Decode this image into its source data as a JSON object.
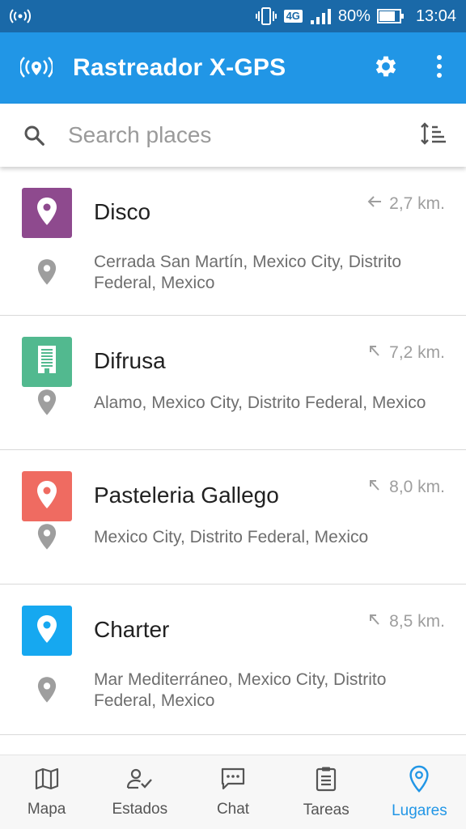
{
  "status_bar": {
    "network": "4G",
    "battery_percent_text": "80%",
    "battery_level": 0.8,
    "time": "13:04"
  },
  "app_bar": {
    "title": "Rastreador X-GPS",
    "icons": [
      "gps-tracker-logo-icon",
      "settings-gear-icon",
      "more-vertical-icon"
    ]
  },
  "search": {
    "placeholder": "Search places",
    "value": ""
  },
  "places": [
    {
      "name": "Disco",
      "distance": "2,7 km.",
      "direction_icon": "arrow-left-icon",
      "address": "Cerrada San Martín, Mexico City, Distrito Federal, Mexico",
      "badge_color": "#8e4a8e",
      "badge_icon": "location-pin-icon"
    },
    {
      "name": "Difrusa",
      "distance": "7,2 km.",
      "direction_icon": "arrow-up-left-icon",
      "address": "Alamo, Mexico City, Distrito Federal, Mexico",
      "badge_color": "#52b98f",
      "badge_icon": "office-building-icon"
    },
    {
      "name": "Pasteleria Gallego",
      "distance": "8,0 km.",
      "direction_icon": "arrow-up-left-icon",
      "address": "Mexico City, Distrito Federal, Mexico",
      "badge_color": "#ef6b61",
      "badge_icon": "location-pin-icon"
    },
    {
      "name": "Charter",
      "distance": "8,5 km.",
      "direction_icon": "arrow-up-left-icon",
      "address": "Mar Mediterráneo, Mexico City, Distrito Federal, Mexico",
      "badge_color": "#16a8f0",
      "badge_icon": "location-pin-icon"
    }
  ],
  "bottom_nav": [
    {
      "label": "Mapa",
      "icon": "map-icon",
      "active": false
    },
    {
      "label": "Estados",
      "icon": "person-check-icon",
      "active": false
    },
    {
      "label": "Chat",
      "icon": "chat-bubble-icon",
      "active": false
    },
    {
      "label": "Tareas",
      "icon": "clipboard-list-icon",
      "active": false
    },
    {
      "label": "Lugares",
      "icon": "location-pin-icon",
      "active": true
    }
  ],
  "colors": {
    "status_bar": "#1a69a8",
    "app_bar": "#2196e6",
    "active_nav": "#2196e6"
  }
}
